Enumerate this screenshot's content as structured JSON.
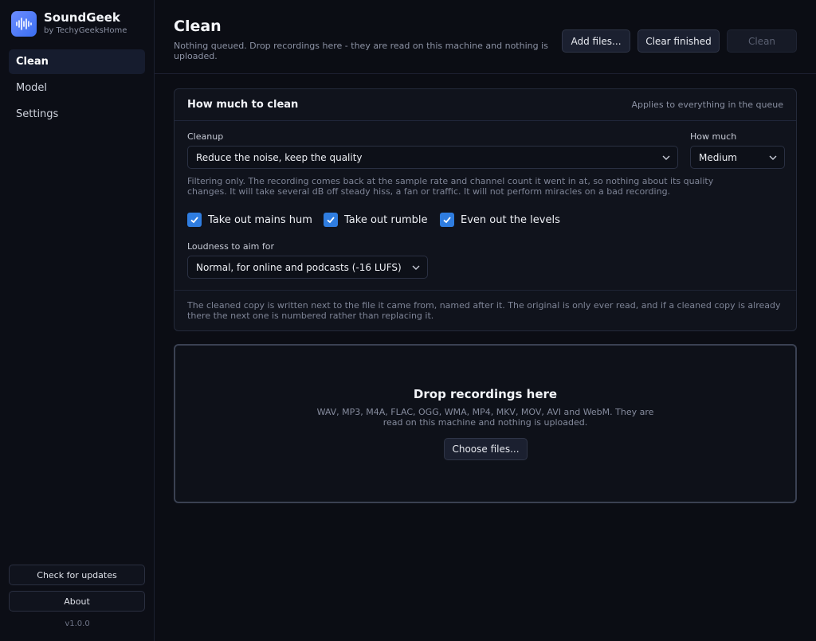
{
  "app": {
    "name": "SoundGeek",
    "publisher": "by TechyGeeksHome",
    "version": "v1.0.0"
  },
  "sidebar": {
    "items": [
      {
        "label": "Clean",
        "active": true
      },
      {
        "label": "Model",
        "active": false
      },
      {
        "label": "Settings",
        "active": false
      }
    ],
    "check_updates_label": "Check for updates",
    "about_label": "About"
  },
  "header": {
    "title": "Clean",
    "subtitle": "Nothing queued. Drop recordings here - they are read on this machine and nothing is uploaded.",
    "add_files_label": "Add files...",
    "clear_finished_label": "Clear finished",
    "clean_label": "Clean"
  },
  "settings_card": {
    "title": "How much to clean",
    "note": "Applies to everything in the queue",
    "cleanup_label": "Cleanup",
    "cleanup_value": "Reduce the noise, keep the quality",
    "how_much_label": "How much",
    "how_much_value": "Medium",
    "help_text": "Filtering only. The recording comes back at the sample rate and channel count it went in at, so nothing about its quality changes. It will take several dB off steady hiss, a fan or traffic. It will not perform miracles on a bad recording.",
    "options": [
      {
        "label": "Take out mains hum",
        "checked": true
      },
      {
        "label": "Take out rumble",
        "checked": true
      },
      {
        "label": "Even out the levels",
        "checked": true
      }
    ],
    "loudness_label": "Loudness to aim for",
    "loudness_value": "Normal, for online and podcasts (-16 LUFS)",
    "footer_text": "The cleaned copy is written next to the file it came from, named after it. The original is only ever read, and if a cleaned copy is already there the next one is numbered rather than replacing it."
  },
  "dropzone": {
    "title": "Drop recordings here",
    "subtitle": "WAV, MP3, M4A, FLAC, OGG, WMA, MP4, MKV, MOV, AVI and WebM. They are read on this machine and nothing is uploaded.",
    "button_label": "Choose files..."
  },
  "colors": {
    "accent": "#2f7de0",
    "background": "#0b0d14",
    "panel": "#10131c"
  },
  "icons": [
    "soundwave-logo-icon",
    "chevron-down-icon",
    "checkmark-icon"
  ]
}
